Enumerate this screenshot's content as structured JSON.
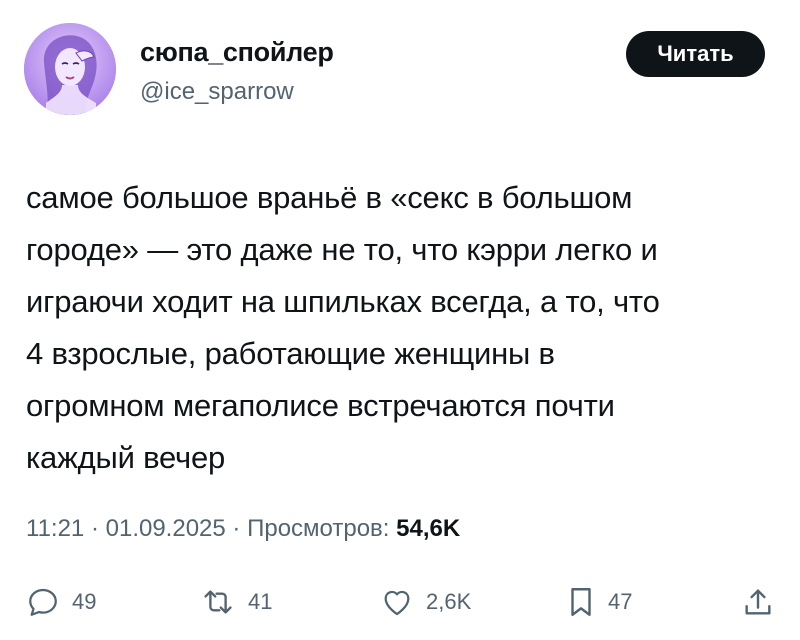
{
  "author": {
    "name": "сюпа_спойлер",
    "handle": "@ice_sparrow"
  },
  "follow_button": {
    "label": "Читать"
  },
  "tweet": {
    "lines": [
      "самое большое враньё в «секс в большом",
      "городе» — это даже не то, что кэрри легко и",
      "играючи ходит на шпильках всегда, а то, что",
      "4 взрослые, работающие женщины в",
      "огромном мегаполисе встречаются почти",
      "каждый вечер"
    ]
  },
  "meta": {
    "time": "11:21",
    "separator": "·",
    "date": "01.09.2025",
    "views_label": "Просмотров:",
    "views_count": "54,6K"
  },
  "actions": {
    "replies": {
      "icon": "reply-icon",
      "count": "49"
    },
    "reposts": {
      "icon": "repost-icon",
      "count": "41"
    },
    "likes": {
      "icon": "heart-icon",
      "count": "2,6K"
    },
    "bookmarks": {
      "icon": "bookmark-icon",
      "count": "47"
    },
    "share": {
      "icon": "share-icon"
    }
  },
  "colors": {
    "text_primary": "#0f1419",
    "text_secondary": "#536471",
    "button_bg": "#0f1419",
    "button_text": "#ffffff",
    "avatar_bg": "#c9a6f2"
  }
}
